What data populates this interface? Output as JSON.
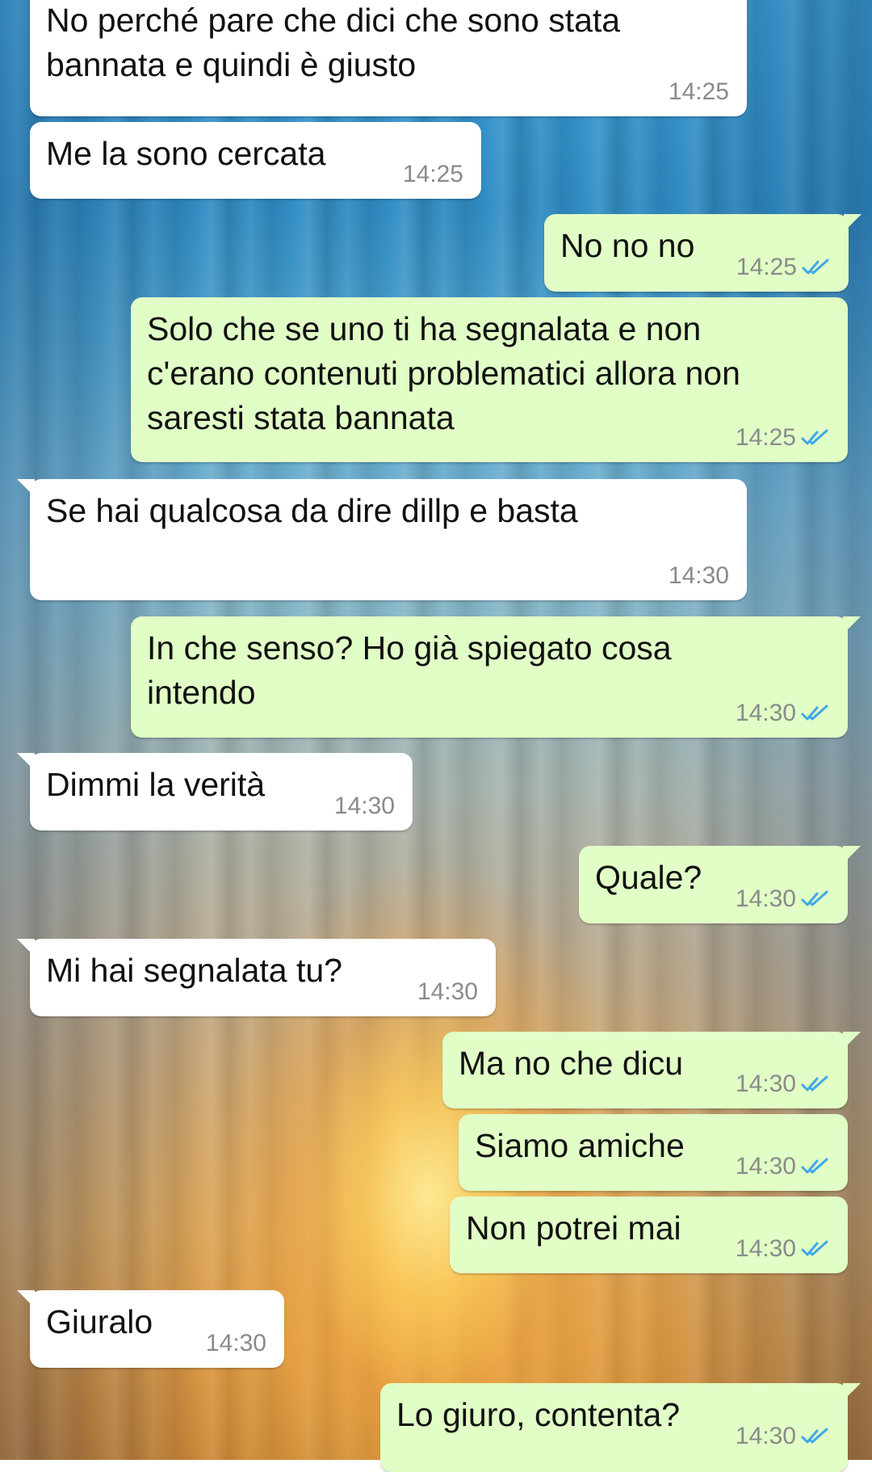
{
  "colors": {
    "incoming_bubble": "#ffffff",
    "outgoing_bubble": "#e1fec6",
    "timestamp": "#8a8a8a",
    "read_ticks": "#3fa8e8"
  },
  "messages": [
    {
      "direction": "in",
      "text": "No perché pare che dici che sono stata\nbannata e quindi è giusto",
      "time": "14:25"
    },
    {
      "direction": "in",
      "text": "Me la sono cercata",
      "time": "14:25"
    },
    {
      "direction": "out",
      "text": "No no no",
      "time": "14:25",
      "status": "read-double-tick-icon"
    },
    {
      "direction": "out",
      "text": "Solo che se uno ti ha segnalata e non\nc'erano contenuti problematici allora non\nsaresti stata bannata",
      "time": "14:25",
      "status": "read-double-tick-icon"
    },
    {
      "direction": "in",
      "text": "Se hai qualcosa da dire dillp e basta",
      "time": "14:30"
    },
    {
      "direction": "out",
      "text": "In che senso? Ho già spiegato cosa\nintendo",
      "time": "14:30",
      "status": "read-double-tick-icon"
    },
    {
      "direction": "in",
      "text": "Dimmi la verità",
      "time": "14:30"
    },
    {
      "direction": "out",
      "text": "Quale?",
      "time": "14:30",
      "status": "read-double-tick-icon"
    },
    {
      "direction": "in",
      "text": "Mi hai segnalata tu?",
      "time": "14:30"
    },
    {
      "direction": "out",
      "text": "Ma no che dicu",
      "time": "14:30",
      "status": "read-double-tick-icon"
    },
    {
      "direction": "out",
      "text": "Siamo amiche",
      "time": "14:30",
      "status": "read-double-tick-icon"
    },
    {
      "direction": "out",
      "text": "Non potrei mai",
      "time": "14:30",
      "status": "read-double-tick-icon"
    },
    {
      "direction": "in",
      "text": "Giuralo",
      "time": "14:30"
    },
    {
      "direction": "out",
      "text": "Lo giuro, contenta?",
      "time": "14:30",
      "status": "read-double-tick-icon"
    }
  ]
}
